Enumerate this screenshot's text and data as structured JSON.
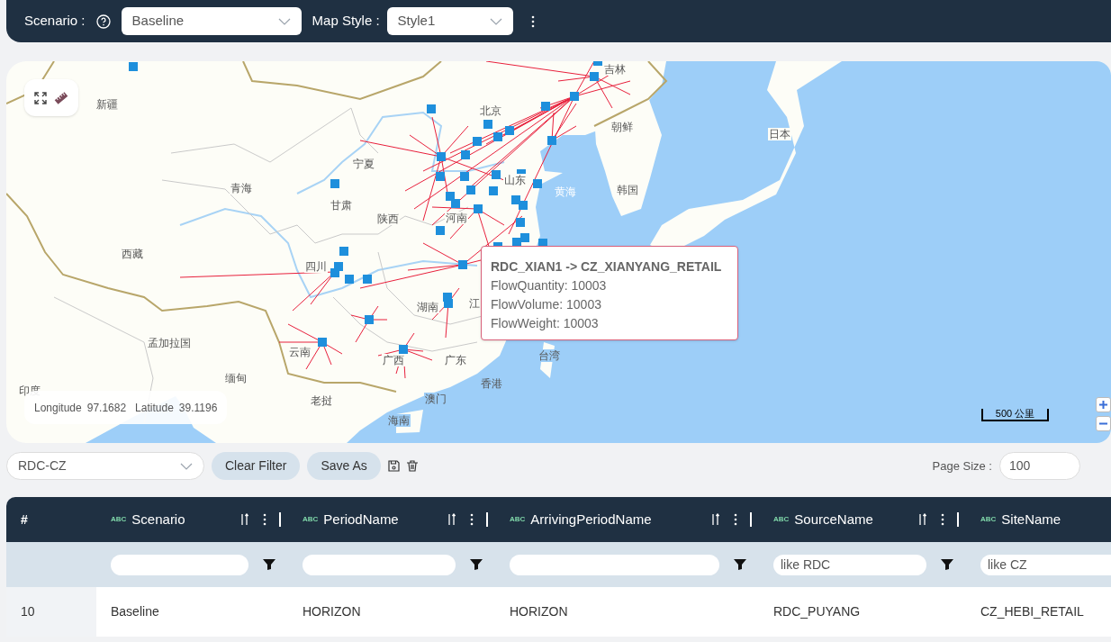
{
  "toolbar": {
    "scenario_label": "Scenario :",
    "scenario_value": "Baseline",
    "map_style_label": "Map Style :",
    "map_style_value": "Style1"
  },
  "map": {
    "place_labels": [
      "新疆",
      "青海",
      "西藏",
      "宁夏",
      "甘肃",
      "陕西",
      "四川",
      "北京",
      "山东",
      "河南",
      "湖南",
      "云南",
      "广西",
      "广东",
      "澳门",
      "香港",
      "海南",
      "台湾",
      "老挝",
      "缅甸",
      "孟加拉国",
      "印度",
      "朝鲜",
      "韩国",
      "日本",
      "黄海",
      "吉林",
      "江"
    ],
    "tooltip": {
      "title": "RDC_XIAN1 -> CZ_XIANYANG_RETAIL",
      "lines": [
        "FlowQuantity: 10003",
        "FlowVolume: 10003",
        "FlowWeight: 10003"
      ]
    },
    "coordinates": {
      "longitude_label": "Longitude",
      "longitude": "97.1682",
      "latitude_label": "Latitude",
      "latitude": "39.1196"
    },
    "scale": "500 公里"
  },
  "filter_bar": {
    "view": "RDC-CZ",
    "buttons": [
      "Clear Filter",
      "Save As"
    ],
    "page_size_label": "Page Size :",
    "page_size": "100"
  },
  "table": {
    "number_heading": "#",
    "columns": [
      {
        "type": "ABC",
        "name": "Scenario"
      },
      {
        "type": "ABC",
        "name": "PeriodName"
      },
      {
        "type": "ABC",
        "name": "ArrivingPeriodName"
      },
      {
        "type": "ABC",
        "name": "SourceName",
        "filter": "like RDC"
      },
      {
        "type": "ABC",
        "name": "SiteName",
        "filter": "like CZ"
      }
    ],
    "rows": [
      {
        "number": "10",
        "cells": [
          "Baseline",
          "HORIZON",
          "HORIZON",
          "RDC_PUYANG",
          "CZ_HEBI_RETAIL"
        ]
      }
    ]
  }
}
